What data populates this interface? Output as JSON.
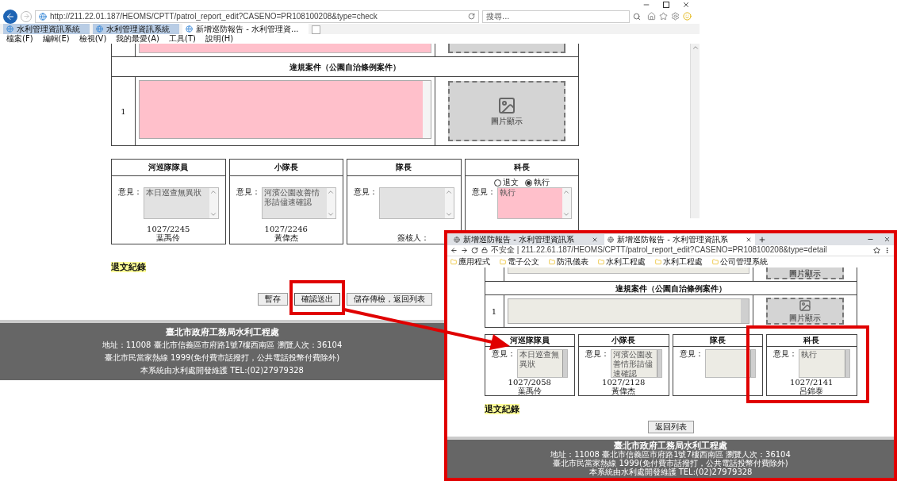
{
  "browser": {
    "url": "http://211.22.01.187/HEOMS/CPTT/patrol_report_edit?CASENO=PR108100208&type=check",
    "search": {
      "placeholder": "搜尋..."
    },
    "tabs": [
      {
        "label": "水利管理資訊系統",
        "selected": false
      },
      {
        "label": "水利管理資訊系統",
        "selected": false
      },
      {
        "label": "新增巡防報告 - 水利管理資...",
        "selected": true
      }
    ],
    "menu": [
      "檔案(F)",
      "編輯(E)",
      "檢視(V)",
      "我的最愛(A)",
      "工具(T)",
      "說明(H)"
    ]
  },
  "page": {
    "section_title": "違規案件（公園自治條例案件）",
    "rows": [
      {
        "number": "1",
        "editable": true,
        "image_label": "圖片顯示"
      }
    ],
    "signoff": [
      {
        "role": "河巡隊隊員",
        "opinion_label": "意見：",
        "opinion": "本日巡查無異狀",
        "editable": false,
        "date": "1027/2245",
        "signer": "葉禹伶"
      },
      {
        "role": "小隊長",
        "opinion_label": "意見：",
        "opinion": "河濱公園改善情形請儘速確認",
        "editable": false,
        "date": "1027/2246",
        "signer": "黃偉杰"
      },
      {
        "role": "隊長",
        "opinion_label": "意見：",
        "editable": false,
        "signer_label": "簽核人："
      },
      {
        "role": "科長",
        "opinion_label": "意見：",
        "opinion": "執行",
        "editable": true,
        "options": [
          {
            "label": "退文",
            "selected": false
          },
          {
            "label": "執行",
            "selected": true
          }
        ]
      }
    ],
    "record_title": "退文紀錄",
    "buttons": [
      {
        "label": "暫存",
        "highlighted": false
      },
      {
        "label": "確認送出",
        "highlighted": true
      },
      {
        "label": "儲存傳檢，返回列表",
        "highlighted": false
      }
    ],
    "footer": [
      "臺北市政府工務局水利工程處",
      "地址：11008 臺北市信義區市府路1號7樓西南區 瀏覽人次：36104",
      "臺北市民當家熱線 1999(免付費市話撥打，公共電話投幣付費除外)",
      "本系統由水利處開發維護 TEL:(02)27979328"
    ]
  },
  "inset": {
    "tabs": [
      {
        "label": "新增巡防報告 - 水利管理資訊系",
        "selected": false
      },
      {
        "label": "新增巡防報告 - 水利管理資訊系",
        "selected": true
      }
    ],
    "url": "不安全 | 211.22.61.187/HEOMS/CPTT/patrol_report_edit?CASENO=PR108100208&type=detail",
    "bookmarks": [
      "應用程式",
      "電子公文",
      "防汛儀表",
      "水利工程處",
      "水利工程處",
      "公司管理系統"
    ],
    "page": {
      "top_image_label": "圖片顯示",
      "section_title": "違規案件（公園自治條例案件）",
      "rows": [
        {
          "number": "1",
          "editable": false,
          "image_label": "圖片顯示"
        }
      ],
      "signoff": [
        {
          "role": "河巡隊隊員",
          "opinion_label": "意見：",
          "opinion": "本日巡查無異狀",
          "editable": false,
          "date": "1027/2058",
          "signer": "葉禹伶",
          "highlighted": false
        },
        {
          "role": "小隊長",
          "opinion_label": "意見：",
          "opinion": "河濱公園改善情形請儘速確認",
          "editable": false,
          "date": "1027/2128",
          "signer": "黃偉杰",
          "highlighted": false
        },
        {
          "role": "隊長",
          "opinion_label": "意見：",
          "editable": false,
          "highlighted": false
        },
        {
          "role": "科長",
          "opinion_label": "意見：",
          "opinion": "執行",
          "editable": false,
          "date": "1027/2141",
          "signer": "呂錦泰",
          "highlighted": true
        }
      ],
      "record_title": "退文紀錄",
      "buttons": [
        {
          "label": "返回列表",
          "highlighted": false
        }
      ],
      "footer": [
        "臺北市政府工務局水利工程處",
        "地址：11008 臺北市信義區市府路1號7樓西南區 瀏覽人次：36104",
        "臺北市民當家熱線 1999(免付費市話撥打，公共電話投幣付費除外)",
        "本系統由水利處開發維護 TEL:(02)27979328"
      ]
    }
  }
}
